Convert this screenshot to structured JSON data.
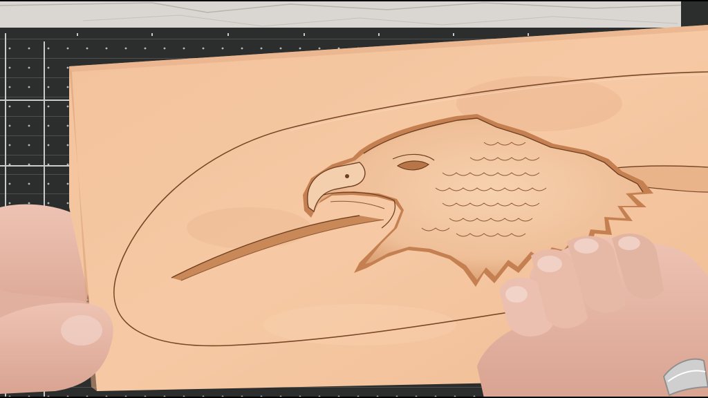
{
  "scene": {
    "palette": {
      "leather": "#f5c6a0",
      "leather_shadow": "#c98a5c",
      "tooling_line": "#6e3f20",
      "mat": "#2a2d2c",
      "mat_grid": "#9fa3a1",
      "tabletop": "#dcdad6",
      "skin": "#e6b9a8",
      "skin_shadow": "#b98475"
    },
    "objects": {
      "leather_panel": "tooled-leather-panel",
      "carving": "eagle-head-carving",
      "border": "oval-border-groove",
      "mat": "cutting-mat",
      "left_hand": "left-hand",
      "right_hand": "right-hand",
      "ring": "wedding-ring"
    }
  }
}
